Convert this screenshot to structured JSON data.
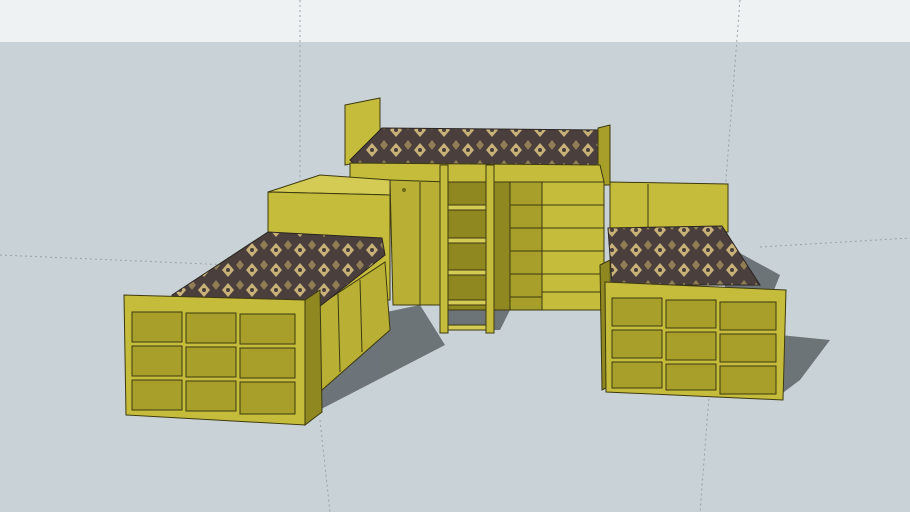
{
  "scene": {
    "kind": "3d-model-render",
    "colors": {
      "sky": "#eef2f2",
      "ground": "#c9d2d6",
      "shadow": "#5d6468",
      "wood_light": "#c6bc3c",
      "wood_mid": "#a89f2a",
      "wood_dark": "#6f6a18",
      "mattress_base": "#4a3f3c",
      "mattress_pattern": "#c9b27a"
    },
    "objects": [
      {
        "name": "loft-bed"
      },
      {
        "name": "left-bed"
      },
      {
        "name": "right-bed"
      },
      {
        "name": "ladder"
      },
      {
        "name": "wardrobe"
      },
      {
        "name": "drawer-chest"
      }
    ]
  }
}
